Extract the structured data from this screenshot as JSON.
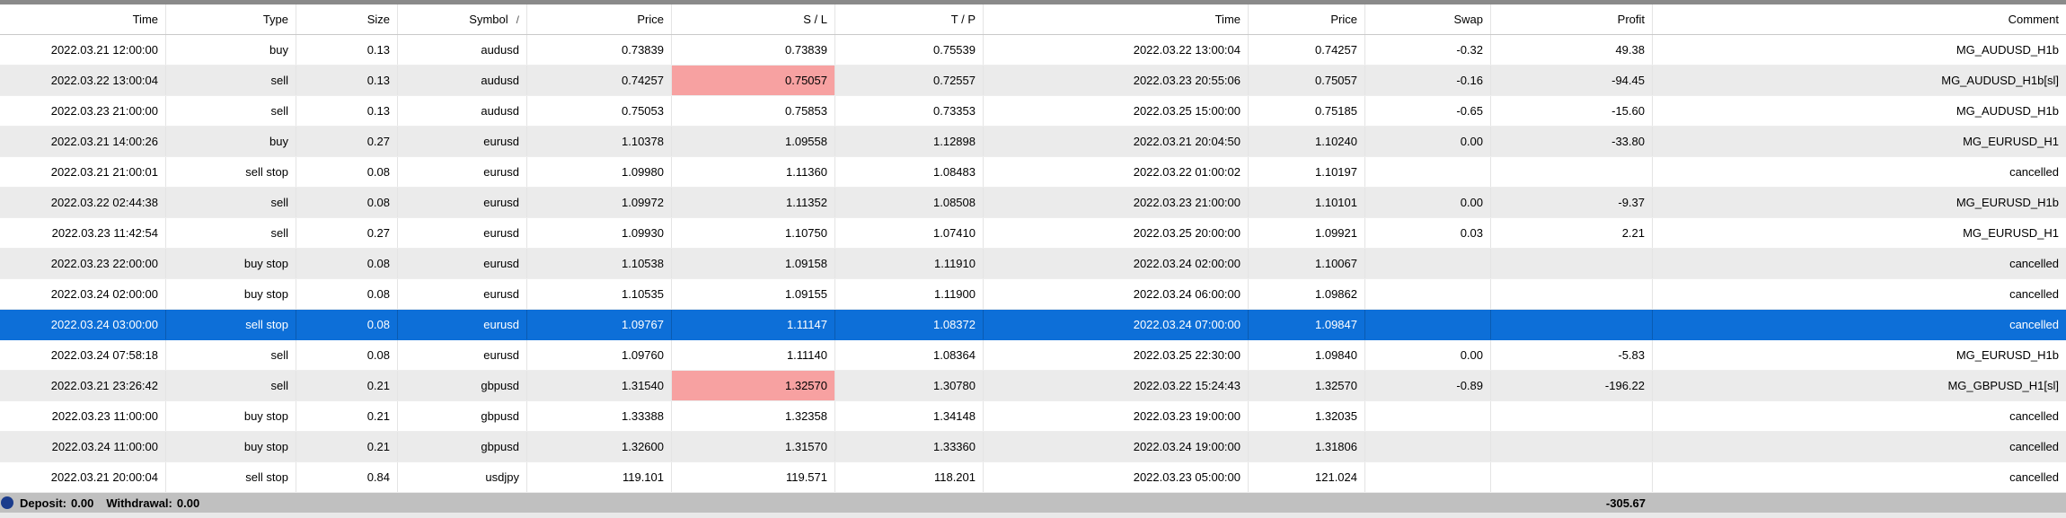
{
  "colors": {
    "selected_row": "#0d6fd8",
    "sl_highlight": "#f7a1a1",
    "footer_bar": "#c0c0c0",
    "alt_row": "#ebebeb",
    "top_border": "#8a8a8a"
  },
  "header": {
    "columns": [
      "Time",
      "Type",
      "Size",
      "Symbol",
      "Price",
      "S / L",
      "T / P",
      "Time",
      "Price",
      "Swap",
      "Profit",
      "Comment"
    ],
    "symbol_sort_indicator": "/"
  },
  "rows": [
    {
      "time": "2022.03.21 12:00:00",
      "type": "buy",
      "size": "0.13",
      "symbol": "audusd",
      "price": "0.73839",
      "sl": "0.73839",
      "tp": "0.75539",
      "close_time": "2022.03.22 13:00:04",
      "close_price": "0.74257",
      "swap": "-0.32",
      "profit": "49.38",
      "comment": "MG_AUDUSD_H1b"
    },
    {
      "time": "2022.03.22 13:00:04",
      "type": "sell",
      "size": "0.13",
      "symbol": "audusd",
      "price": "0.74257",
      "sl": "0.75057",
      "tp": "0.72557",
      "close_time": "2022.03.23 20:55:06",
      "close_price": "0.75057",
      "swap": "-0.16",
      "profit": "-94.45",
      "comment": "MG_AUDUSD_H1b[sl]",
      "sl_highlight": true
    },
    {
      "time": "2022.03.23 21:00:00",
      "type": "sell",
      "size": "0.13",
      "symbol": "audusd",
      "price": "0.75053",
      "sl": "0.75853",
      "tp": "0.73353",
      "close_time": "2022.03.25 15:00:00",
      "close_price": "0.75185",
      "swap": "-0.65",
      "profit": "-15.60",
      "comment": "MG_AUDUSD_H1b"
    },
    {
      "time": "2022.03.21 14:00:26",
      "type": "buy",
      "size": "0.27",
      "symbol": "eurusd",
      "price": "1.10378",
      "sl": "1.09558",
      "tp": "1.12898",
      "close_time": "2022.03.21 20:04:50",
      "close_price": "1.10240",
      "swap": "0.00",
      "profit": "-33.80",
      "comment": "MG_EURUSD_H1"
    },
    {
      "time": "2022.03.21 21:00:01",
      "type": "sell stop",
      "size": "0.08",
      "symbol": "eurusd",
      "price": "1.09980",
      "sl": "1.11360",
      "tp": "1.08483",
      "close_time": "2022.03.22 01:00:02",
      "close_price": "1.10197",
      "swap": "",
      "profit": "",
      "comment": "cancelled"
    },
    {
      "time": "2022.03.22 02:44:38",
      "type": "sell",
      "size": "0.08",
      "symbol": "eurusd",
      "price": "1.09972",
      "sl": "1.11352",
      "tp": "1.08508",
      "close_time": "2022.03.23 21:00:00",
      "close_price": "1.10101",
      "swap": "0.00",
      "profit": "-9.37",
      "comment": "MG_EURUSD_H1b"
    },
    {
      "time": "2022.03.23 11:42:54",
      "type": "sell",
      "size": "0.27",
      "symbol": "eurusd",
      "price": "1.09930",
      "sl": "1.10750",
      "tp": "1.07410",
      "close_time": "2022.03.25 20:00:00",
      "close_price": "1.09921",
      "swap": "0.03",
      "profit": "2.21",
      "comment": "MG_EURUSD_H1"
    },
    {
      "time": "2022.03.23 22:00:00",
      "type": "buy stop",
      "size": "0.08",
      "symbol": "eurusd",
      "price": "1.10538",
      "sl": "1.09158",
      "tp": "1.11910",
      "close_time": "2022.03.24 02:00:00",
      "close_price": "1.10067",
      "swap": "",
      "profit": "",
      "comment": "cancelled"
    },
    {
      "time": "2022.03.24 02:00:00",
      "type": "buy stop",
      "size": "0.08",
      "symbol": "eurusd",
      "price": "1.10535",
      "sl": "1.09155",
      "tp": "1.11900",
      "close_time": "2022.03.24 06:00:00",
      "close_price": "1.09862",
      "swap": "",
      "profit": "",
      "comment": "cancelled"
    },
    {
      "time": "2022.03.24 03:00:00",
      "type": "sell stop",
      "size": "0.08",
      "symbol": "eurusd",
      "price": "1.09767",
      "sl": "1.11147",
      "tp": "1.08372",
      "close_time": "2022.03.24 07:00:00",
      "close_price": "1.09847",
      "swap": "",
      "profit": "",
      "comment": "cancelled",
      "selected": true
    },
    {
      "time": "2022.03.24 07:58:18",
      "type": "sell",
      "size": "0.08",
      "symbol": "eurusd",
      "price": "1.09760",
      "sl": "1.11140",
      "tp": "1.08364",
      "close_time": "2022.03.25 22:30:00",
      "close_price": "1.09840",
      "swap": "0.00",
      "profit": "-5.83",
      "comment": "MG_EURUSD_H1b"
    },
    {
      "time": "2022.03.21 23:26:42",
      "type": "sell",
      "size": "0.21",
      "symbol": "gbpusd",
      "price": "1.31540",
      "sl": "1.32570",
      "tp": "1.30780",
      "close_time": "2022.03.22 15:24:43",
      "close_price": "1.32570",
      "swap": "-0.89",
      "profit": "-196.22",
      "comment": "MG_GBPUSD_H1[sl]",
      "sl_highlight": true
    },
    {
      "time": "2022.03.23 11:00:00",
      "type": "buy stop",
      "size": "0.21",
      "symbol": "gbpusd",
      "price": "1.33388",
      "sl": "1.32358",
      "tp": "1.34148",
      "close_time": "2022.03.23 19:00:00",
      "close_price": "1.32035",
      "swap": "",
      "profit": "",
      "comment": "cancelled"
    },
    {
      "time": "2022.03.24 11:00:00",
      "type": "buy stop",
      "size": "0.21",
      "symbol": "gbpusd",
      "price": "1.32600",
      "sl": "1.31570",
      "tp": "1.33360",
      "close_time": "2022.03.24 19:00:00",
      "close_price": "1.31806",
      "swap": "",
      "profit": "",
      "comment": "cancelled"
    },
    {
      "time": "2022.03.21 20:00:04",
      "type": "sell stop",
      "size": "0.84",
      "symbol": "usdjpy",
      "price": "119.101",
      "sl": "119.571",
      "tp": "118.201",
      "close_time": "2022.03.23 05:00:00",
      "close_price": "121.024",
      "swap": "",
      "profit": "",
      "comment": "cancelled"
    }
  ],
  "footer": {
    "deposit_label": "Deposit:",
    "deposit_value": "0.00",
    "withdrawal_label": "Withdrawal:",
    "withdrawal_value": "0.00",
    "total_profit": "-305.67"
  }
}
